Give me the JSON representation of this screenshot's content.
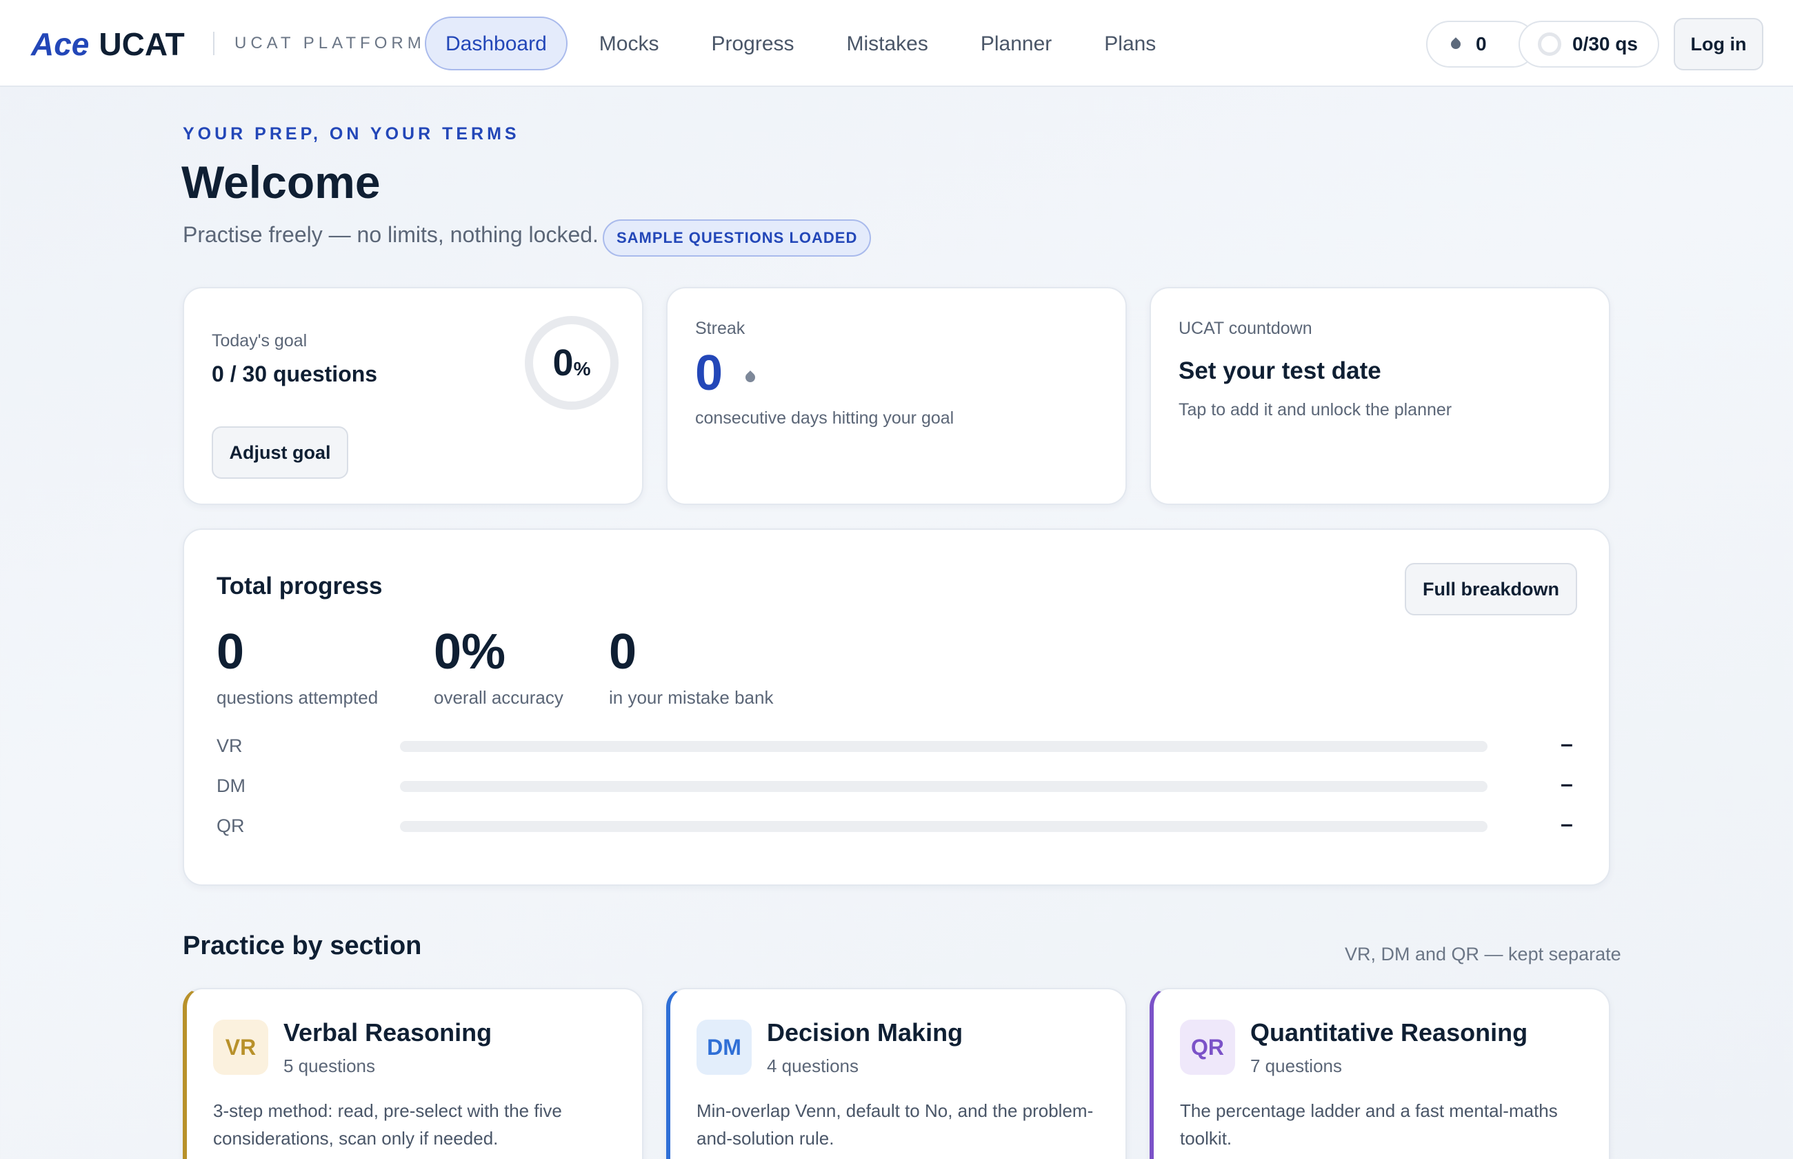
{
  "header": {
    "logo_ace": "Ace",
    "logo_ucat": "UCAT",
    "platform_label": "UCAT PLATFORM",
    "nav": [
      "Dashboard",
      "Mocks",
      "Progress",
      "Mistakes",
      "Planner",
      "Plans"
    ],
    "active_nav": "Dashboard",
    "streak_count": "0",
    "daily_goal": "0/30 qs",
    "login_label": "Log in"
  },
  "hero": {
    "eyebrow": "YOUR PREP, ON YOUR TERMS",
    "title": "Welcome",
    "subtitle": "Practise freely — no limits, nothing locked.",
    "badge": "SAMPLE QUESTIONS LOADED"
  },
  "goal_card": {
    "label": "Today's goal",
    "value": "0 / 30 questions",
    "percent": "0",
    "percent_sign": "%",
    "progress_fraction": 0,
    "button": "Adjust goal"
  },
  "streak_card": {
    "label": "Streak",
    "value": "0",
    "caption": "consecutive days hitting your goal"
  },
  "countdown_card": {
    "label": "UCAT countdown",
    "title": "Set your test date",
    "caption": "Tap to add it and unlock the planner"
  },
  "total_progress": {
    "title": "Total progress",
    "button": "Full breakdown",
    "stats": [
      {
        "value": "0",
        "label": "questions attempted"
      },
      {
        "value": "0%",
        "label": "overall accuracy"
      },
      {
        "value": "0",
        "label": "in your mistake bank"
      }
    ],
    "bars": [
      {
        "label": "VR",
        "value": "–",
        "fraction": 0
      },
      {
        "label": "DM",
        "value": "–",
        "fraction": 0
      },
      {
        "label": "QR",
        "value": "–",
        "fraction": 0
      }
    ]
  },
  "practice": {
    "title": "Practice by section",
    "note": "VR, DM and QR — kept separate",
    "sections": [
      {
        "code": "VR",
        "name": "Verbal Reasoning",
        "count": "5 questions",
        "desc": "3-step method: read, pre-select with the five considerations, scan only if needed.",
        "color": "#b8912a"
      },
      {
        "code": "DM",
        "name": "Decision Making",
        "count": "4 questions",
        "desc": "Min-overlap Venn, default to No, and the problem-and-solution rule.",
        "color": "#2f6fd6"
      },
      {
        "code": "QR",
        "name": "Quantitative Reasoning",
        "count": "7 questions",
        "desc": "The percentage ladder and a fast mental-maths toolkit.",
        "color": "#7b52c8"
      }
    ]
  }
}
